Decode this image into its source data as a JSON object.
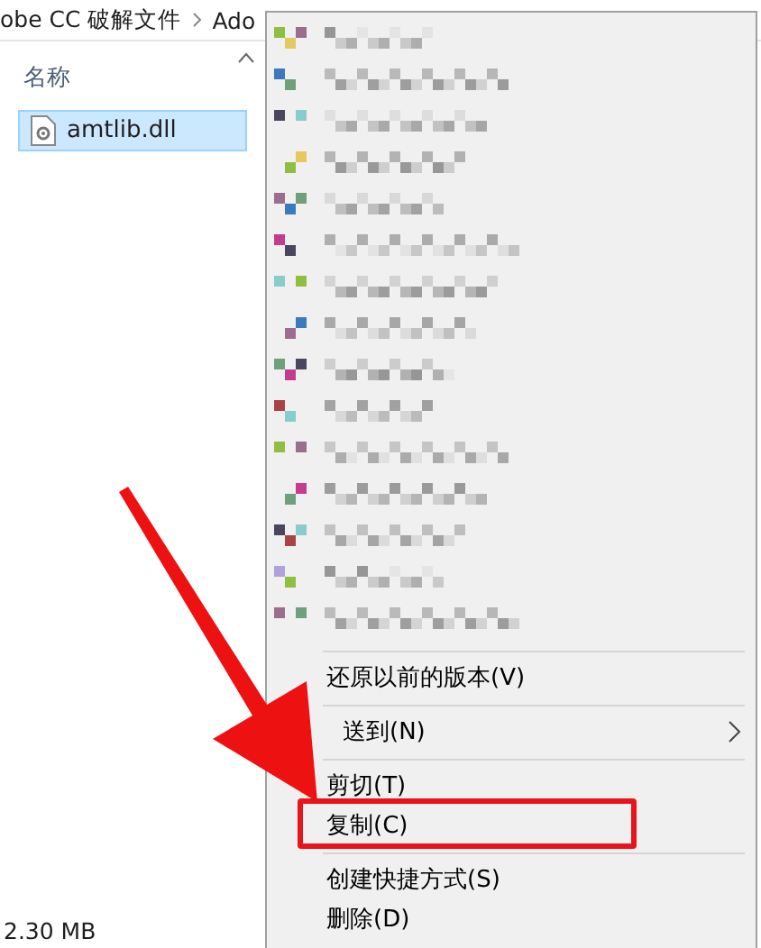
{
  "breadcrumb": [
    {
      "label": "obe CC 破解文件"
    },
    {
      "label": "Ado"
    }
  ],
  "column": {
    "label": "名称"
  },
  "files": [
    {
      "name": "amtlib.dll",
      "selected": true
    }
  ],
  "status": {
    "size": "2.30 MB"
  },
  "menu": {
    "items": [
      {
        "kind": "separator"
      },
      {
        "kind": "item",
        "label": "还原以前的版本(V)",
        "highlighted": false
      },
      {
        "kind": "separator"
      },
      {
        "kind": "submenu",
        "label": "送到(N)",
        "highlighted": false
      },
      {
        "kind": "separator"
      },
      {
        "kind": "item",
        "label": "剪切(T)",
        "highlighted": false
      },
      {
        "kind": "item",
        "label": "复制(C)",
        "highlighted": true
      },
      {
        "kind": "separator"
      },
      {
        "kind": "item",
        "label": "创建快捷方式(S)",
        "highlighted": false
      },
      {
        "kind": "item",
        "label": "删除(D)",
        "highlighted": false
      }
    ]
  }
}
